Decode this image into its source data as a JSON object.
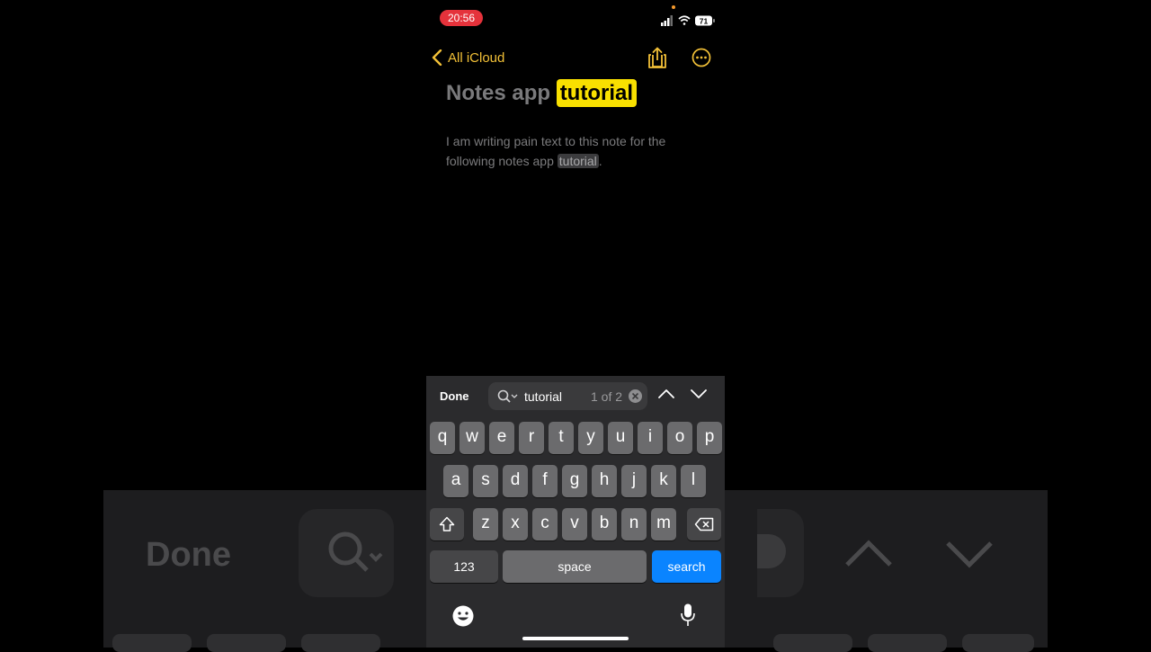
{
  "status": {
    "time": "20:56",
    "battery": "71"
  },
  "nav": {
    "back_label": "All iCloud"
  },
  "note": {
    "title_prefix": "Notes app",
    "title_match": "tutorial",
    "body_prefix": "I am writing pain text to this note for the following notes app",
    "body_match": "tutorial",
    "body_suffix": "."
  },
  "find": {
    "done_label": "Done",
    "query": "tutorial",
    "count": "1 of 2"
  },
  "keyboard": {
    "row1": [
      "q",
      "w",
      "e",
      "r",
      "t",
      "y",
      "u",
      "i",
      "o",
      "p"
    ],
    "row2": [
      "a",
      "s",
      "d",
      "f",
      "g",
      "h",
      "j",
      "k",
      "l"
    ],
    "row3": [
      "z",
      "x",
      "c",
      "v",
      "b",
      "n",
      "m"
    ],
    "numbers_label": "123",
    "space_label": "space",
    "search_label": "search"
  },
  "background_echo": {
    "done_label": "Done"
  },
  "colors": {
    "accent": "#f2c037",
    "highlight": "#f9e000",
    "search_key": "#0a84ff",
    "time_pill": "#e5323b"
  }
}
